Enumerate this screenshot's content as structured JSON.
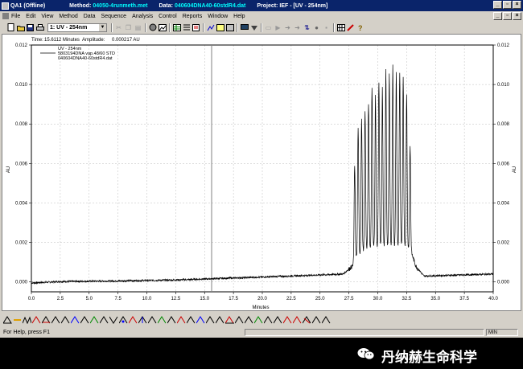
{
  "window": {
    "app_title": "QA1 (Offline)",
    "method_label": "Method:",
    "method_value": "04050-4runmeth.met",
    "data_label": "Data:",
    "data_value": "040604DNA40-60stdR4.dat",
    "project_label": "Project:",
    "project_value": "IEF - [UV - 254nm]",
    "min_glyph": "_",
    "max_glyph": "▫",
    "close_glyph": "×"
  },
  "menu": [
    "File",
    "Edit",
    "View",
    "Method",
    "Data",
    "Sequence",
    "Analysis",
    "Control",
    "Reports",
    "Window",
    "Help"
  ],
  "toolbar": {
    "channel_select": "1: UV - 254nm",
    "dropdown_glyph": "▼"
  },
  "chart_header": {
    "time_label": "Time:",
    "time_value": "15.6112 Minutes",
    "amp_label": "Amplitude:",
    "amp_value": "0.000217 AU"
  },
  "legend": {
    "title": "UV - 254nm",
    "entry1": "5803194DNA vap.48/60  STD",
    "entry2": "040604DNA40-60stdR4.dat"
  },
  "status": {
    "help_text": "For Help, press F1",
    "units": "MIN"
  },
  "footer": {
    "brand": "丹纳赫生命科学"
  },
  "colors": {
    "title_bg": "#0a246a",
    "title_value": "#00ffff",
    "trace": "#000000",
    "cursor_line": "#808080"
  },
  "chart_data": {
    "type": "line",
    "xlabel": "Minutes",
    "ylabel": "AU",
    "xlim": [
      0,
      40
    ],
    "ylim": [
      -0.0005,
      0.012
    ],
    "x_ticks": [
      "0.0",
      "2.5",
      "5.0",
      "7.5",
      "10.0",
      "12.5",
      "15.0",
      "17.5",
      "20.0",
      "22.5",
      "25.0",
      "27.5",
      "30.0",
      "32.5",
      "35.0",
      "37.5",
      "40.0"
    ],
    "y_ticks": [
      "0.000",
      "0.002",
      "0.004",
      "0.006",
      "0.008",
      "0.010",
      "0.012"
    ],
    "y_tick_values": [
      0,
      0.002,
      0.004,
      0.006,
      0.008,
      0.01,
      0.012
    ],
    "grid": true,
    "cursor_x": 15.6112,
    "series": [
      {
        "name": "UV - 254nm",
        "baseline_points": [
          [
            0.0,
            -5e-05
          ],
          [
            2.5,
            2e-05
          ],
          [
            7.5,
            5e-05
          ],
          [
            12.5,
            0.0001
          ],
          [
            17.5,
            0.0002
          ],
          [
            22.5,
            0.0003
          ],
          [
            27.0,
            0.0004
          ],
          [
            27.8,
            0.0008
          ],
          [
            28.3,
            0.0014
          ],
          [
            29.0,
            0.0017
          ],
          [
            30.0,
            0.0018
          ],
          [
            31.0,
            0.0018
          ],
          [
            32.0,
            0.0019
          ],
          [
            32.8,
            0.0017
          ],
          [
            33.3,
            0.0008
          ],
          [
            34.0,
            0.0003
          ],
          [
            40.0,
            0.0004
          ]
        ],
        "peaks": [
          [
            28.0,
            0.0059
          ],
          [
            28.3,
            0.0078
          ],
          [
            28.6,
            0.0082
          ],
          [
            28.9,
            0.0087
          ],
          [
            29.2,
            0.0091
          ],
          [
            29.5,
            0.0099
          ],
          [
            29.8,
            0.0094
          ],
          [
            30.1,
            0.0102
          ],
          [
            30.4,
            0.0098
          ],
          [
            30.7,
            0.0108
          ],
          [
            31.0,
            0.0105
          ],
          [
            31.3,
            0.0109
          ],
          [
            31.6,
            0.0107
          ],
          [
            31.9,
            0.0106
          ],
          [
            32.2,
            0.0103
          ],
          [
            32.5,
            0.0095
          ],
          [
            32.8,
            0.0069
          ]
        ]
      }
    ]
  }
}
